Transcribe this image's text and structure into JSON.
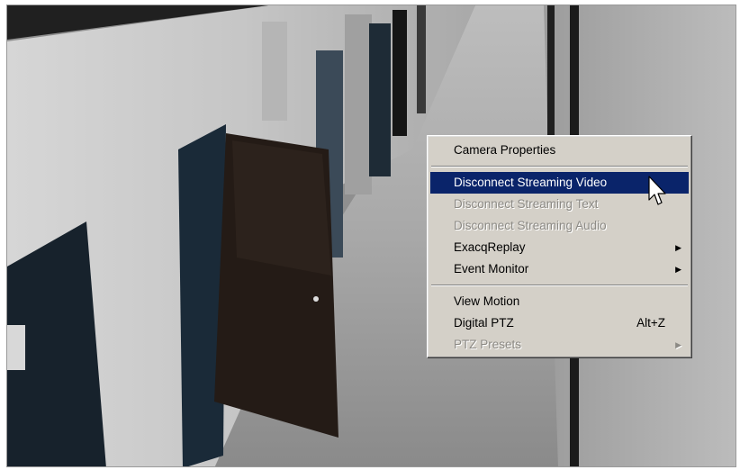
{
  "feed": {
    "description_icon": "camera-feed"
  },
  "context_menu": {
    "items": [
      {
        "label": "Camera Properties",
        "state": "normal"
      },
      {
        "label": "Disconnect Streaming Video",
        "state": "selected"
      },
      {
        "label": "Disconnect Streaming Text",
        "state": "disabled"
      },
      {
        "label": "Disconnect Streaming Audio",
        "state": "disabled"
      },
      {
        "label": "ExacqReplay",
        "state": "normal",
        "submenu": true
      },
      {
        "label": "Event Monitor",
        "state": "normal",
        "submenu": true
      },
      {
        "label": "View Motion",
        "state": "normal"
      },
      {
        "label": "Digital PTZ",
        "state": "normal",
        "shortcut": "Alt+Z"
      },
      {
        "label": "PTZ Presets",
        "state": "disabled",
        "submenu": true
      }
    ],
    "submenu_arrow": "▶",
    "colors": {
      "menu_bg": "#d4d0c8",
      "highlight": "#0a246a",
      "disabled_text": "#8c8a85"
    }
  }
}
